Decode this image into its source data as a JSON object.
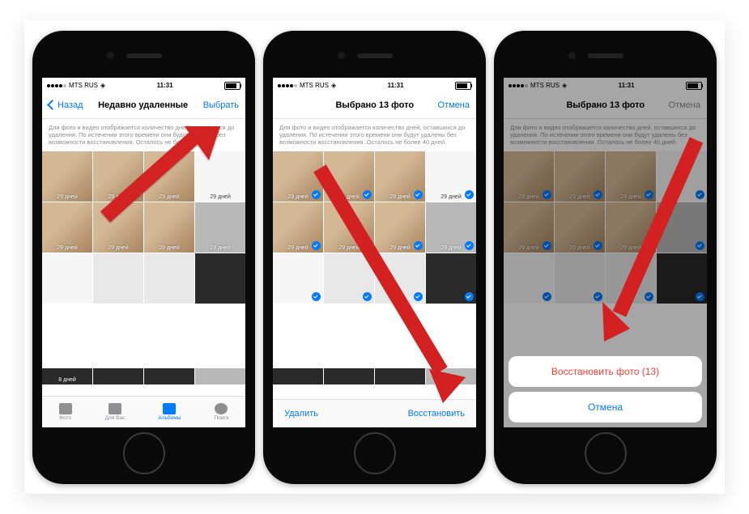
{
  "statusbar": {
    "carrier": "MTS RUS",
    "time": "11:31"
  },
  "phones": [
    {
      "nav": {
        "left": "Назад",
        "title": "Недавно удаленные",
        "right": "Выбрать"
      },
      "info": "Для фото и видео отображается количество дней, оставшихся до удаления. По истечении этого времени они будут удалены без возможности восстановления. Осталось не более 40 дней.",
      "days_label": "29 дней",
      "short_days_label": "8 дней",
      "tabs": [
        {
          "label": "Фото"
        },
        {
          "label": "Для Вас"
        },
        {
          "label": "Альбомы",
          "active": true
        },
        {
          "label": "Поиск"
        }
      ]
    },
    {
      "nav": {
        "title": "Выбрано 13 фото",
        "right": "Отмена"
      },
      "info": "Для фото и видео отображается количество дней, оставшихся до удаления. По истечении этого времени они будут удалены без возможности восстановления. Осталось не более 40 дней.",
      "days_label": "29 дней",
      "toolbar": {
        "delete": "Удалить",
        "restore": "Восстановить"
      }
    },
    {
      "nav": {
        "title": "Выбрано 13 фото",
        "right": "Отмена"
      },
      "info": "Для фото и видео отображается количество дней, оставшихся до удаления. По истечении этого времени они будут удалены без возможности восстановления. Осталось не более 40 дней.",
      "days_label": "29 дней",
      "actionsheet": {
        "restore": "Восстановить фото (13)",
        "cancel": "Отмена"
      }
    }
  ]
}
